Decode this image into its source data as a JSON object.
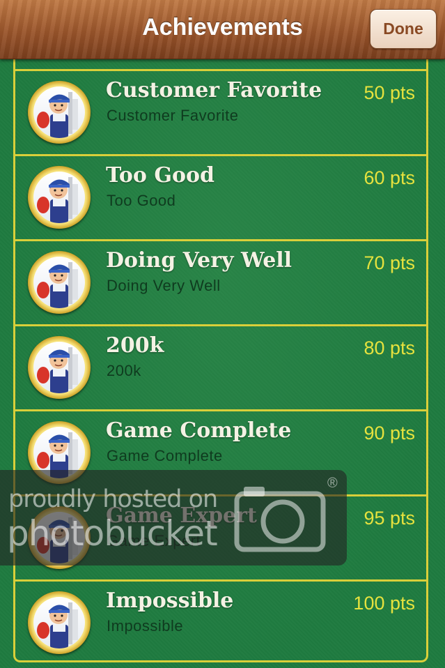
{
  "navbar": {
    "title": "Achievements",
    "done_label": "Done"
  },
  "achievements": [
    {
      "title": "Customer Favorite",
      "subtitle": "Customer Favorite",
      "points": "50 pts"
    },
    {
      "title": "Too Good",
      "subtitle": "Too Good",
      "points": "60 pts"
    },
    {
      "title": "Doing Very Well",
      "subtitle": "Doing Very Well",
      "points": "70 pts"
    },
    {
      "title": "200k",
      "subtitle": "200k",
      "points": "80 pts"
    },
    {
      "title": "Game Complete",
      "subtitle": "Game Complete",
      "points": "90 pts"
    },
    {
      "title": "Game Expert",
      "subtitle": "Game Expert",
      "points": "95 pts"
    },
    {
      "title": "Impossible",
      "subtitle": "Impossible",
      "points": "100 pts"
    }
  ],
  "watermark": {
    "line1": "proudly hosted on",
    "line2": "photobucket",
    "mark": "®"
  },
  "colors": {
    "felt": "#1f7b40",
    "gold_border": "#d9cf3a",
    "points": "#e6e23e",
    "title": "#f4f2e4",
    "subtitle": "#0f3b1f"
  },
  "icons": {
    "badge": "waiter-character-icon",
    "watermark": "camera-icon"
  }
}
